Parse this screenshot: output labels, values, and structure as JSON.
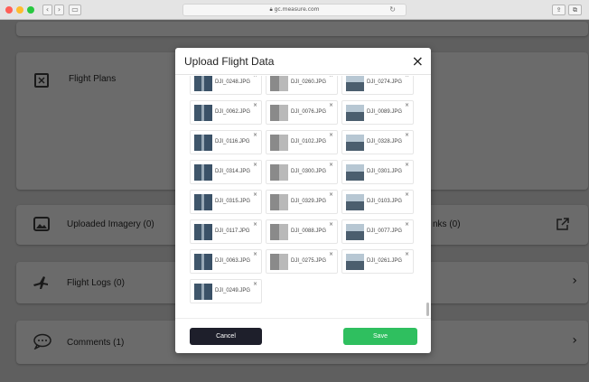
{
  "browser": {
    "url": "gc.measure.com",
    "lock_icon": "lock-icon",
    "colors": {
      "close": "#ff5f57",
      "minimize": "#febc2e",
      "zoom": "#28c840"
    }
  },
  "background": {
    "cards": [
      {
        "label": "Flight Plans",
        "icon": "map-icon"
      },
      {
        "label": "Uploaded Imagery (0)",
        "icon": "image-icon"
      },
      {
        "label": "nks (0)",
        "icon": "external-link-icon"
      },
      {
        "label": "Flight Logs (0)",
        "icon": "airplane-icon"
      },
      {
        "label": "Comments (1)",
        "icon": "chat-icon"
      }
    ]
  },
  "modal": {
    "title": "Upload Flight Data",
    "close_glyph": "×",
    "remove_glyph": "×",
    "files": [
      "DJI_0248.JPG",
      "DJI_0260.JPG",
      "DJI_0274.JPG",
      "DJI_0062.JPG",
      "DJI_0076.JPG",
      "DJI_0089.JPG",
      "DJI_0116.JPG",
      "DJI_0102.JPG",
      "DJI_0328.JPG",
      "DJI_0314.JPG",
      "DJI_0300.JPG",
      "DJI_0301.JPG",
      "DJI_0315.JPG",
      "DJI_0329.JPG",
      "DJI_0103.JPG",
      "DJI_0117.JPG",
      "DJI_0088.JPG",
      "DJI_0077.JPG",
      "DJI_0063.JPG",
      "DJI_0275.JPG",
      "DJI_0261.JPG",
      "DJI_0249.JPG"
    ],
    "cancel_label": "Cancel",
    "save_label": "Save",
    "colors": {
      "save": "#2fbf5f",
      "cancel": "#1e1f2b"
    }
  }
}
